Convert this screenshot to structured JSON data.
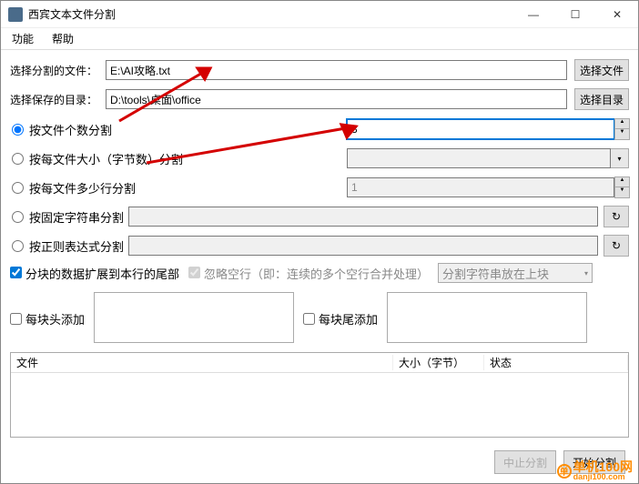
{
  "window": {
    "title": "西宾文本文件分割",
    "min": "—",
    "max": "☐",
    "close": "✕"
  },
  "menu": {
    "func": "功能",
    "help": "帮助"
  },
  "file_row": {
    "label": "选择分割的文件：",
    "value": "E:\\AI攻略.txt",
    "btn": "选择文件"
  },
  "dir_row": {
    "label": "选择保存的目录：",
    "value": "D:\\tools\\桌面\\office",
    "btn": "选择目录"
  },
  "radios": {
    "by_count": "按文件个数分割",
    "by_count_val": "3",
    "by_size": "按每文件大小（字节数）分割",
    "by_lines": "按每文件多少行分割",
    "by_lines_val": "1",
    "by_fixed": "按固定字符串分割",
    "by_regex": "按正则表达式分割"
  },
  "checks": {
    "expand": "分块的数据扩展到本行的尾部",
    "ignore": "忽略空行（即：连续的多个空行合并处理）",
    "split_pos": "分割字符串放在上块"
  },
  "blocks": {
    "head": "每块头添加",
    "tail": "每块尾添加"
  },
  "table": {
    "file": "文件",
    "size": "大小（字节）",
    "status": "状态"
  },
  "buttons": {
    "stop": "中止分割",
    "start": "开始分割"
  },
  "watermark": {
    "text": "单机100网",
    "url": "danji100.com"
  }
}
